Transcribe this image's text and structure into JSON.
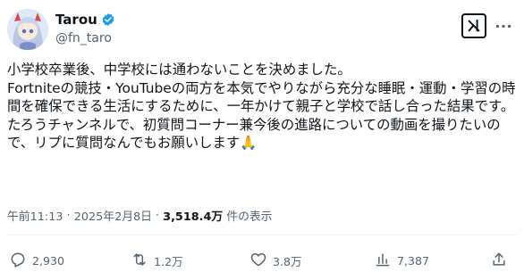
{
  "author": {
    "name": "Tarou",
    "handle": "@fn_taro"
  },
  "tweet": {
    "text": "小学校卒業後、中学校には通わないことを決めました。\nFortniteの競技・YouTubeの両方を本気でやりながら充分な睡眠・運動・学習の時間を確保できる生活にするために、一年かけて親子と学校で話し合った結果です。\nたろうチャンネルで、初質問コーナー兼今後の進路についての動画を撮りたいので、リプに質問なんでもお願いします🙏"
  },
  "meta": {
    "time": "午前11:13",
    "sep1": " · ",
    "date": "2025年2月8日",
    "sep2": " · ",
    "views": "3,518.4万",
    "views_label": " 件の表示"
  },
  "actions": {
    "replies": "2,930",
    "reposts": "1.2万",
    "likes": "3.8万",
    "views": "7,387"
  },
  "icons": {
    "verified": "verified-badge-icon",
    "brand": "grok-icon",
    "more": "more-icon",
    "reply": "reply-icon",
    "repost": "repost-icon",
    "like": "like-icon",
    "views": "views-icon",
    "share": "share-icon"
  },
  "colors": {
    "verified": "#1d9bf0",
    "text": "#0f1419",
    "muted": "#536471"
  }
}
